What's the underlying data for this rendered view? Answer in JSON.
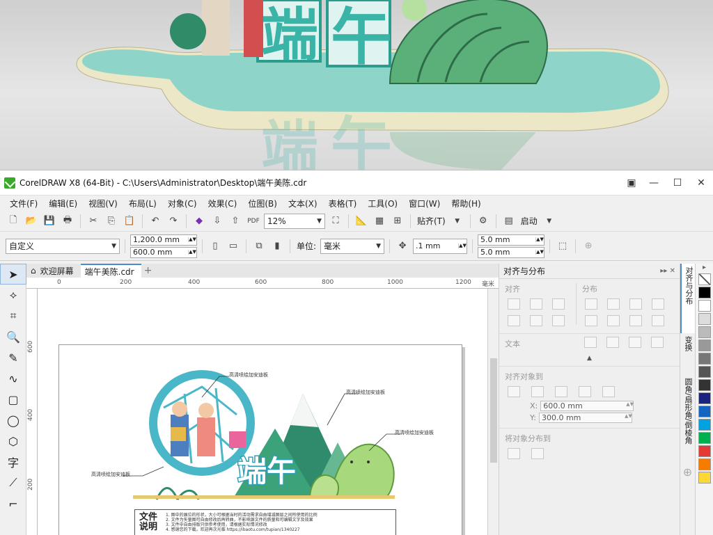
{
  "window": {
    "title": "CorelDRAW X8 (64-Bit) - C:\\Users\\Administrator\\Desktop\\端午美陈.cdr"
  },
  "menu": [
    "文件(F)",
    "编辑(E)",
    "视图(V)",
    "布局(L)",
    "对象(C)",
    "效果(C)",
    "位图(B)",
    "文本(X)",
    "表格(T)",
    "工具(O)",
    "窗口(W)",
    "帮助(H)"
  ],
  "toolbar": {
    "zoom": "12%",
    "snap_label": "贴齐(T)",
    "launch_label": "启动"
  },
  "propbar": {
    "page_preset": "自定义",
    "width": "1,200.0 mm",
    "height": "600.0 mm",
    "units_label": "单位:",
    "units_value": "毫米",
    "nudge": ".1 mm",
    "dup_x": "5.0 mm",
    "dup_y": "5.0 mm"
  },
  "tabs": {
    "welcome": "欢迎屏幕",
    "doc": "端午美陈.cdr"
  },
  "ruler": {
    "h_ticks": [
      "0",
      "200",
      "400",
      "600",
      "800",
      "1000",
      "1200"
    ],
    "h_unit": "毫米",
    "v_ticks": [
      "600",
      "400",
      "200"
    ]
  },
  "artwork": {
    "title_chars": "端午",
    "callout": "高清喷绘加安迪板",
    "note_title": "文件说明",
    "note_lines": [
      "1. 图中的展位的形状，大小可根据当时的活动需求自由增减图层之间所使用的比例",
      "2. 文件为矢量图可自由修改后再转曲，不影响源文件的质量和可编辑文字及效果",
      "3. 文件中自由排版只供参考使用，请根据实际情况修改",
      "4. 感谢您的下载，欢迎再次光临   https://ibaotu.com/tupian/1340227"
    ]
  },
  "docker": {
    "title": "对齐与分布",
    "align_label": "对齐",
    "distribute_label": "分布",
    "text_label": "文本",
    "align_to_label": "对齐对象到",
    "x_label": "X:",
    "x_value": "600.0 mm",
    "y_label": "Y:",
    "y_value": "300.0 mm",
    "distribute_to_label": "将对象分布到"
  },
  "vtabs": [
    "对齐与分布",
    "变换",
    "圆角/扇形角/倒棱角"
  ],
  "palette": [
    "#ffffff",
    "#000000",
    "#ffffff",
    "#d9d9d9",
    "#1a237e",
    "#1565c0",
    "#00a3e0",
    "#00b050",
    "#e53935",
    "#f57c00",
    "#fdd835"
  ]
}
